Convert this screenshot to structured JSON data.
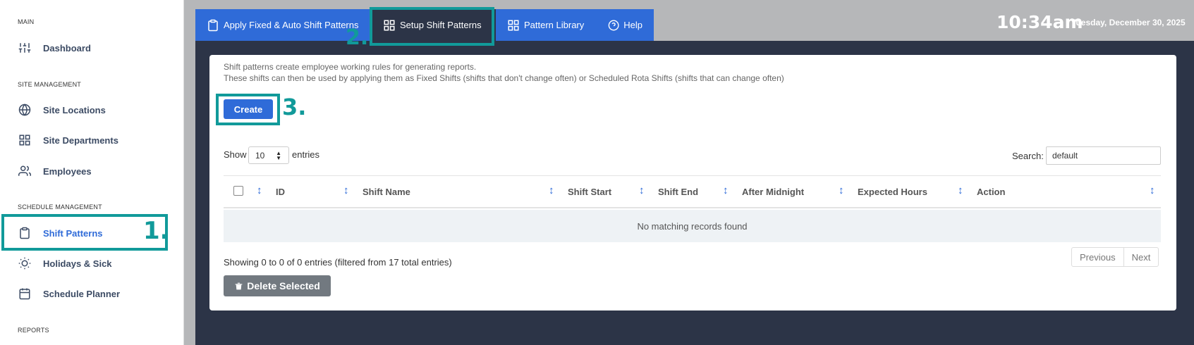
{
  "sidebar": {
    "sections": [
      {
        "title": "MAIN"
      },
      {
        "title": "SITE MANAGEMENT"
      },
      {
        "title": "SCHEDULE MANAGEMENT"
      },
      {
        "title": "REPORTS"
      }
    ],
    "items": [
      {
        "label": "Dashboard",
        "icon": "sliders-icon"
      },
      {
        "label": "Site Locations",
        "icon": "globe-icon"
      },
      {
        "label": "Site Departments",
        "icon": "grid-icon"
      },
      {
        "label": "Employees",
        "icon": "users-icon"
      },
      {
        "label": "Shift Patterns",
        "icon": "clipboard-icon",
        "active": true
      },
      {
        "label": "Holidays & Sick",
        "icon": "sun-icon"
      },
      {
        "label": "Schedule Planner",
        "icon": "calendar-icon"
      }
    ]
  },
  "tabs": [
    {
      "label": "Apply Fixed & Auto Shift Patterns",
      "icon": "clipboard-icon"
    },
    {
      "label": "Setup Shift Patterns",
      "icon": "grid-icon",
      "active": true
    },
    {
      "label": "Pattern Library",
      "icon": "grid-icon"
    },
    {
      "label": "Help",
      "icon": "help-circle-icon"
    }
  ],
  "header": {
    "time": "10:34am",
    "date": "Tuesday, December 30, 2025"
  },
  "annotations": {
    "step1": "1.",
    "step2": "2.",
    "step3": "3.",
    "highlight_color": "#119a9a"
  },
  "main": {
    "intro_line1": "Shift patterns create employee working rules for generating reports.",
    "intro_line2": "These shifts can then be used by applying them as Fixed Shifts (shifts that don't change often) or Scheduled Rota Shifts (shifts that can change often)",
    "create_label": "Create",
    "show_label": "Show",
    "entries_value": "10",
    "entries_label": "entries",
    "search_label": "Search:",
    "search_value": "default",
    "columns": [
      "ID",
      "Shift Name",
      "Shift Start",
      "Shift End",
      "After Midnight",
      "Expected Hours",
      "Action"
    ],
    "empty_message": "No matching records found",
    "info": "Showing 0 to 0 of 0 entries (filtered from 17 total entries)",
    "prev_label": "Previous",
    "next_label": "Next",
    "delete_label": "Delete Selected"
  },
  "colors": {
    "accent": "#2f6bd8",
    "dark_panel": "#2c3447",
    "highlight": "#119a9a"
  }
}
